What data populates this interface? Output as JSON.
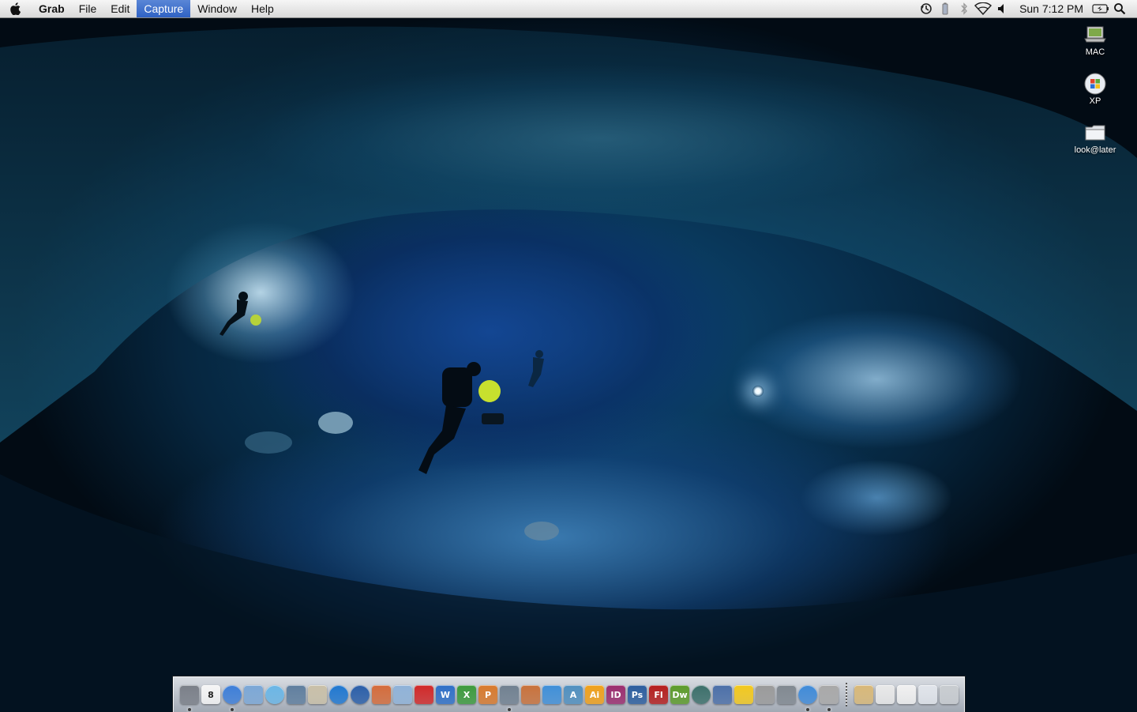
{
  "menubar": {
    "app_name": "Grab",
    "menus": [
      "File",
      "Edit",
      "Capture",
      "Window",
      "Help"
    ],
    "active_menu": "Capture",
    "clock": "Sun 7:12 PM"
  },
  "desktop_icons": [
    {
      "label": "MAC",
      "icon": "laptop-icon"
    },
    {
      "label": "XP",
      "icon": "windows-logo-icon"
    },
    {
      "label": "look@later",
      "icon": "folder-icon"
    }
  ],
  "dock": {
    "apps": [
      {
        "icon": "finder-icon",
        "color": "#7a7f88",
        "running": true
      },
      {
        "icon": "ical-icon",
        "color": "#f5f5f5",
        "glyph": "8",
        "running": false
      },
      {
        "icon": "safari-icon",
        "color": "#3d7ed8",
        "running": true
      },
      {
        "icon": "mail-stamp-icon",
        "color": "#7ba7d6",
        "running": false
      },
      {
        "icon": "itunes-icon",
        "color": "#6ab6e6",
        "running": false
      },
      {
        "icon": "iphoto-icon",
        "color": "#5f7e9e",
        "running": false
      },
      {
        "icon": "preview-icon",
        "color": "#c9c0a8",
        "running": false
      },
      {
        "icon": "quicktime-icon",
        "color": "#1f77d0",
        "running": false
      },
      {
        "icon": "google-earth-icon",
        "color": "#2a5ea8",
        "running": false
      },
      {
        "icon": "script-editor-icon",
        "color": "#d46b3a",
        "running": false
      },
      {
        "icon": "bird-icon",
        "color": "#8fb2d8",
        "running": false
      },
      {
        "icon": "poker-icon",
        "color": "#d12828",
        "running": false
      },
      {
        "icon": "word-icon",
        "color": "#2e6fc7",
        "glyph": "W",
        "running": false
      },
      {
        "icon": "excel-icon",
        "color": "#3c9a3c",
        "glyph": "X",
        "running": false
      },
      {
        "icon": "powerpoint-icon",
        "color": "#d8792c",
        "glyph": "P",
        "running": false
      },
      {
        "icon": "pen-tool-icon",
        "color": "#708090",
        "running": true
      },
      {
        "icon": "keynote-icon",
        "color": "#c8713b",
        "running": false
      },
      {
        "icon": "numbers-icon",
        "color": "#3f8fd8",
        "running": false
      },
      {
        "icon": "font-book-icon",
        "color": "#4f8fbf",
        "glyph": "A",
        "running": false
      },
      {
        "icon": "illustrator-icon",
        "color": "#f0a01a",
        "glyph": "Ai",
        "running": false
      },
      {
        "icon": "indesign-icon",
        "color": "#9b2c6e",
        "glyph": "ID",
        "running": false
      },
      {
        "icon": "photoshop-icon",
        "color": "#2b5d9e",
        "glyph": "Ps",
        "running": false
      },
      {
        "icon": "flash-icon",
        "color": "#b51d1d",
        "glyph": "Fl",
        "running": false
      },
      {
        "icon": "dreamweaver-icon",
        "color": "#5c9b2a",
        "glyph": "Dw",
        "running": false
      },
      {
        "icon": "time-machine-icon",
        "color": "#3b6f6a",
        "running": false
      },
      {
        "icon": "spaces-icon",
        "color": "#4b6fa8",
        "running": false
      },
      {
        "icon": "adium-duck-icon",
        "color": "#f2c81e",
        "running": false
      },
      {
        "icon": "printer-icon",
        "color": "#9a9a9a",
        "running": false
      },
      {
        "icon": "system-preferences-icon",
        "color": "#808890",
        "running": false
      },
      {
        "icon": "ichat-icon",
        "color": "#3f8ad8",
        "running": true
      },
      {
        "icon": "grab-icon",
        "color": "#a8a8a8",
        "running": true
      }
    ],
    "stacks": [
      {
        "icon": "documents-stack-icon",
        "color": "#d8b878"
      },
      {
        "icon": "files-stack-icon",
        "color": "#e8e8e8"
      },
      {
        "icon": "pages-stack-icon",
        "color": "#f0f0f0"
      },
      {
        "icon": "downloads-stack-icon",
        "color": "#e0e4ea"
      },
      {
        "icon": "trash-icon",
        "color": "#c8ccd0"
      }
    ]
  }
}
